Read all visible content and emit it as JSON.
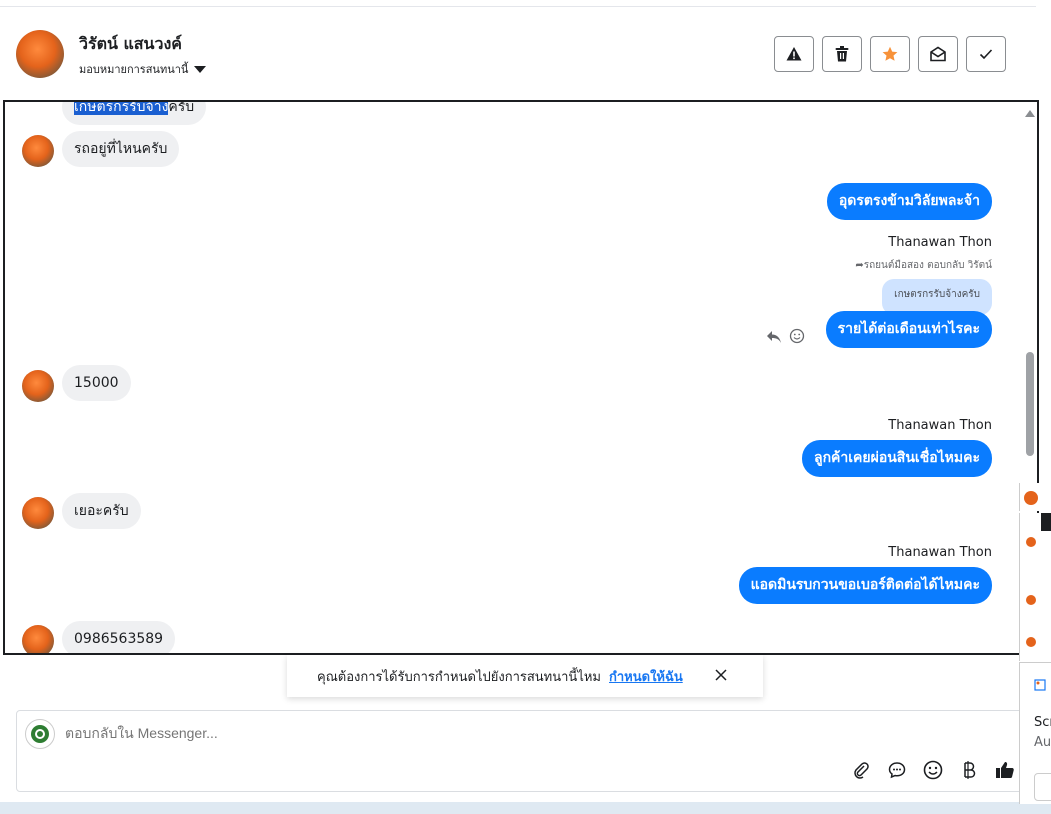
{
  "header": {
    "contact_name": "วิรัตน์ แสนวงค์",
    "assign_label": "มอบหมายการสนทนานี้",
    "actions": [
      {
        "name": "report-button",
        "icon": "warning-icon"
      },
      {
        "name": "delete-button",
        "icon": "trash-icon"
      },
      {
        "name": "star-button",
        "icon": "star-icon"
      },
      {
        "name": "mark-unread-button",
        "icon": "envelope-open-icon"
      },
      {
        "name": "done-button",
        "icon": "check-icon"
      }
    ]
  },
  "messages": {
    "top_partial_highlight": "เกษตรกรรับจ้าง",
    "top_partial_rest": "ครับ",
    "m1": "รถอยู่ที่ไหนครับ",
    "m2": "อุดรตรงข้ามวิลัยพละจ้า",
    "sender1": "Thanawan Thon",
    "reply_note": "รถยนต์มือสอง ตอบกลับ วิรัตน์",
    "quoted": "เกษตรกรรับจ้างครับ",
    "m3": "รายได้ต่อเดือนเท่าไรคะ",
    "m4": "15000",
    "sender2": "Thanawan Thon",
    "m5": "ลูกค้าเคยผ่อนสินเชื่อไหมคะ",
    "m6": "เยอะครับ",
    "sender3": "Thanawan Thon",
    "m7": "แอดมินรบกวนขอเบอร์ติดต่อได้ไหมคะ",
    "m8": "0986563589"
  },
  "banner": {
    "text": "คุณต้องการได้รับการกำหนดไปยังการสนทนานี้ไหม",
    "link": "กำหนดให้ฉัน"
  },
  "composer": {
    "placeholder": "ตอบกลับใน Messenger..."
  },
  "side": {
    "line1": "Scr",
    "line2": "Aut"
  },
  "colors": {
    "outgoing": "#0a7cff",
    "incoming": "#eff0f2",
    "star": "#f7923a",
    "link": "#1877f2"
  }
}
